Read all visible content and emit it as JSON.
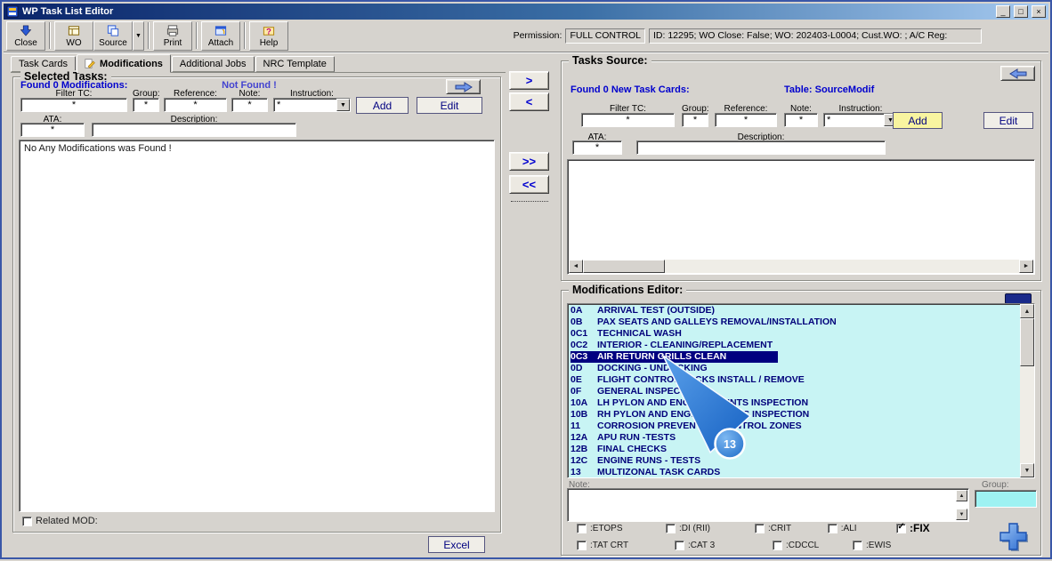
{
  "colors": {
    "selection": "#000080",
    "list_background": "#c8f4f4",
    "blue_text": "#0000cd",
    "annotation_blue": "#1f7fd4"
  },
  "titlebar": {
    "title": "WP Task List Editor"
  },
  "toolbar": {
    "buttons": [
      {
        "label": "Close"
      },
      {
        "label": "WO"
      },
      {
        "label": "Source"
      },
      {
        "label": "Print"
      },
      {
        "label": "Attach"
      },
      {
        "label": "Help"
      }
    ],
    "permission_label": "Permission:",
    "permission_value": "FULL CONTROL",
    "session_info": "ID: 12295; WO Close: False; WO: 202403-L0004; Cust.WO: ; A/C Reg:"
  },
  "tabs": {
    "items": [
      {
        "label": "Task Cards"
      },
      {
        "label": "Modifications"
      },
      {
        "label": "Additional Jobs"
      },
      {
        "label": "NRC Template"
      }
    ]
  },
  "selected_tasks": {
    "title": "Selected Tasks:",
    "found_label": "Found 0 Modifications:",
    "status": "Not Found !",
    "filters": {
      "filter_tc_label": "Filter TC:",
      "filter_tc_value": "*",
      "group_label": "Group:",
      "group_value": "*",
      "reference_label": "Reference:",
      "reference_value": "*",
      "note_label": "Note:",
      "note_value": "*",
      "instruction_label": "Instruction:",
      "instruction_value": "*"
    },
    "ata_label": "ATA:",
    "ata_value": "*",
    "description_label": "Description:",
    "description_value": "",
    "add_label": "Add",
    "edit_label": "Edit",
    "list_message": "No Any Modifications was Found !",
    "related_mod_label": "Related MOD:",
    "excel_label": "Excel"
  },
  "transfer": {
    "move_right": ">",
    "move_left": "<",
    "move_all_right": ">>",
    "move_all_left": "<<"
  },
  "tasks_source": {
    "title": "Tasks Source:",
    "found_label": "Found 0 New Task Cards:",
    "table_label": "Table: SourceModif",
    "filters": {
      "filter_tc_label": "Filter TC:",
      "filter_tc_value": "*",
      "group_label": "Group:",
      "group_value": "*",
      "reference_label": "Reference:",
      "reference_value": "*",
      "note_label": "Note:",
      "note_value": "*",
      "instruction_label": "Instruction:",
      "instruction_value": "*"
    },
    "ata_label": "ATA:",
    "ata_value": "*",
    "description_label": "Description:",
    "description_value": "",
    "add_label": "Add",
    "edit_label": "Edit"
  },
  "modifications_editor": {
    "title": "Modifications Editor:",
    "items": [
      {
        "code": "0A",
        "name": "ARRIVAL TEST (OUTSIDE)",
        "selected": false
      },
      {
        "code": "0B",
        "name": "PAX SEATS AND GALLEYS REMOVAL/INSTALLATION",
        "selected": false
      },
      {
        "code": "0C1",
        "name": "TECHNICAL WASH",
        "selected": false
      },
      {
        "code": "0C2",
        "name": "INTERIOR - CLEANING/REPLACEMENT",
        "selected": false
      },
      {
        "code": "0C3",
        "name": "AIR RETURN GRILLS CLEAN",
        "selected": true
      },
      {
        "code": "0D",
        "name": "DOCKING - UNDOCKING",
        "selected": false
      },
      {
        "code": "0E",
        "name": "FLIGHT CONTROL LOCKS INSTALL / REMOVE",
        "selected": false
      },
      {
        "code": "0F",
        "name": "GENERAL INSPECTIONS",
        "selected": false
      },
      {
        "code": "10A",
        "name": "LH PYLON AND ENGINE MOUNTS INSPECTION",
        "selected": false
      },
      {
        "code": "10B",
        "name": "RH PYLON AND ENGINE MOUNTS INSPECTION",
        "selected": false
      },
      {
        "code": "11",
        "name": "CORROSION PREVENTION CONTROL ZONES",
        "selected": false
      },
      {
        "code": "12A",
        "name": "APU RUN -TESTS",
        "selected": false
      },
      {
        "code": "12B",
        "name": "FINAL CHECKS",
        "selected": false
      },
      {
        "code": "12C",
        "name": "ENGINE RUNS - TESTS",
        "selected": false
      },
      {
        "code": "13",
        "name": "MULTIZONAL TASK CARDS",
        "selected": false
      }
    ],
    "note_label": "Note:",
    "group_label": "Group:",
    "flags_row1": [
      {
        "label": ":ETOPS",
        "checked": false
      },
      {
        "label": ":DI (RII)",
        "checked": false
      },
      {
        "label": ":CRIT",
        "checked": false
      },
      {
        "label": ":ALI",
        "checked": false
      },
      {
        "label": ":FIX",
        "checked": true
      }
    ],
    "flags_row2": [
      {
        "label": ":TAT CRT",
        "checked": false
      },
      {
        "label": ":CAT 3",
        "checked": false
      },
      {
        "label": ":CDCCL",
        "checked": false
      },
      {
        "label": ":EWIS",
        "checked": false
      }
    ]
  },
  "annotation": {
    "step_number": "13"
  }
}
